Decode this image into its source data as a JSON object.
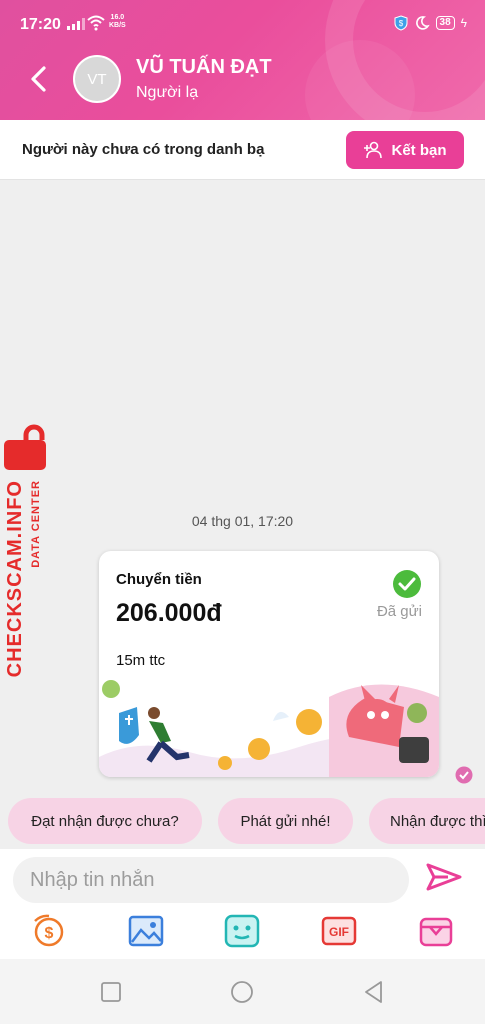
{
  "status_bar": {
    "time": "17:20",
    "net_speed_value": "16.0",
    "net_speed_unit": "KB/S",
    "battery": "38"
  },
  "header": {
    "avatar_initials": "VT",
    "name": "VŨ TUẤN ĐẠT",
    "status": "Người lạ"
  },
  "contact_bar": {
    "message": "Người này chưa có trong danh bạ",
    "add_friend_label": "Kết bạn"
  },
  "watermark": {
    "brand": "CHECKSCAM.INFO",
    "subtitle": "DATA CENTER"
  },
  "chat": {
    "date_label": "04 thg 01, 17:20",
    "transfer": {
      "title": "Chuyển tiền",
      "amount": "206.000đ",
      "note": "15m ttc",
      "status": "Đã gửi"
    }
  },
  "quick_replies": [
    "Đạt nhận được chưa?",
    "Phát gửi nhé!",
    "Nhận được thì"
  ],
  "composer": {
    "placeholder": "Nhập tin nhắn",
    "tools": [
      "money-transfer-icon",
      "image-icon",
      "sticker-icon",
      "gif-icon",
      "gift-icon"
    ],
    "gif_label": "GIF"
  },
  "colors": {
    "brand_pink": "#e93f97",
    "chip_pink": "#f7d3e5",
    "watermark_red": "#e52b2b",
    "check_green": "#4cbb3c"
  }
}
